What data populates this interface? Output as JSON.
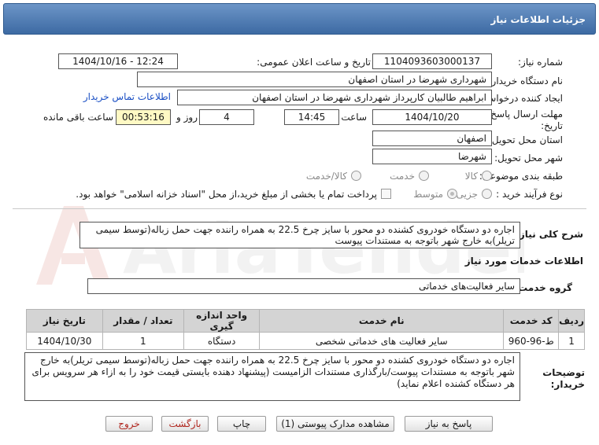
{
  "header": {
    "title": "جزئیات اطلاعات نیاز"
  },
  "form": {
    "need_number": {
      "label": "شماره نیاز:",
      "value": "1104093603000137"
    },
    "announce": {
      "label": "تاریخ و ساعت اعلان عمومی:",
      "value": "1404/10/16 - 12:24"
    },
    "buyer_org": {
      "label": "نام دستگاه خریدار:",
      "value": "شهرداری شهرضا در استان اصفهان"
    },
    "requester": {
      "label": "ایجاد کننده درخواست:",
      "value": "ابراهیم طالبیان کارپرداز شهرداری شهرضا در استان اصفهان",
      "contact_link": "اطلاعات تماس خریدار"
    },
    "deadline": {
      "label_line1": "مهلت ارسال پاسخ: تا",
      "label_line2": "تاریخ:",
      "date": "1404/10/20",
      "time_label": "ساعت",
      "time": "14:45",
      "days": "4",
      "days_label": "روز و",
      "remaining": "00:53:16",
      "remaining_label": "ساعت باقی مانده"
    },
    "province": {
      "label": "استان محل تحویل:",
      "value": "اصفهان"
    },
    "city": {
      "label": "شهر محل تحویل:",
      "value": "شهرضا"
    },
    "category": {
      "label": "طبقه بندی موضوعی:",
      "options": [
        "کالا",
        "خدمت",
        "کالا/خدمت"
      ]
    },
    "process": {
      "label": "نوع فرآیند خرید :",
      "options": [
        "جزیی",
        "متوسط"
      ],
      "payment_text": "پرداخت تمام یا بخشی از مبلغ خرید،از محل \"اسناد خزانه اسلامی\" خواهد بود."
    }
  },
  "summary": {
    "label": "شرح کلی نیاز:",
    "text": "اجاره دو دستگاه خودروی کشنده دو محور با سایز چرخ 22.5 به همراه راننده جهت حمل زباله(توسط سیمی تریلر)به خارج شهر باتوجه به مستندات پیوست"
  },
  "services": {
    "title": "اطلاعات خدمات مورد نیاز",
    "group_label": "گروه خدمت:",
    "group_value": "سایر فعالیت‌های خدماتی",
    "columns": [
      "ردیف",
      "کد خدمت",
      "نام خدمت",
      "واحد اندازه گیری",
      "تعداد / مقدار",
      "تاریخ نیاز"
    ],
    "rows": [
      {
        "row": "1",
        "code": "ط-96-960",
        "name": "سایر فعالیت های خدماتی شخصی",
        "unit": "دستگاه",
        "qty": "1",
        "date": "1404/10/30"
      }
    ]
  },
  "buyer_notes": {
    "label_line1": "توضیحات",
    "label_line2": "خریدار:",
    "text": "اجاره دو دستگاه خودروی کشنده دو محور با سایز چرخ 22.5 به همراه راننده جهت حمل زباله(توسط سیمی تریلر)به خارج شهر باتوجه به مستندات پیوست/بارگذاری مستندات الزامیست (پیشنهاد دهنده بایستی قیمت خود را به ازاء هر سرویس برای هر دستگاه کشنده اعلام نماید)"
  },
  "buttons": {
    "reply": "پاسخ به نیاز",
    "attachments": "مشاهده مدارک پیوستی (1)",
    "print": "چاپ",
    "back": "بازگشت",
    "exit": "خروج"
  },
  "watermark": {
    "text": "AriaTender.net"
  },
  "colors": {
    "header": "#4a76b0",
    "link": "#1a4fc4",
    "highlight": "#fff9c4",
    "exit_text": "#b0261e"
  }
}
